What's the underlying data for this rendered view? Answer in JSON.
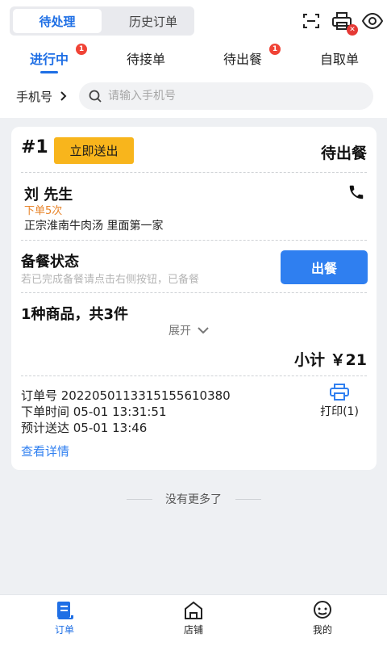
{
  "header": {
    "seg_tabs": [
      {
        "label": "待处理"
      },
      {
        "label": "历史订单"
      }
    ]
  },
  "tabs": [
    {
      "label": "进行中",
      "badge": "1"
    },
    {
      "label": "待接单"
    },
    {
      "label": "待出餐",
      "badge": "1"
    },
    {
      "label": "自取单"
    }
  ],
  "search": {
    "filter_label": "手机号",
    "placeholder": "请输入手机号"
  },
  "order": {
    "number": "#1",
    "deliver_now_label": "立即送出",
    "status": "待出餐",
    "customer_name": "刘 先生",
    "order_count": "下单5次",
    "address": "正宗淮南牛肉汤 里面第一家",
    "prep_title": "备餐状态",
    "prep_hint": "若已完成备餐请点击右侧按钮，已备餐",
    "serve_label": "出餐",
    "goods_summary": "1种商品，共3件",
    "expand_label": "展开",
    "subtotal": "小计 ￥21",
    "order_id_line": "订单号 2022050113315155610380",
    "order_time_line": "下单时间 05-01 13:31:51",
    "delivery_time_line": "预计送达 05-01 13:46",
    "print_label": "打印(1)",
    "detail_link": "查看详情"
  },
  "footer_text": "没有更多了",
  "bottom_nav": [
    {
      "label": "订单"
    },
    {
      "label": "店铺"
    },
    {
      "label": "我的"
    }
  ],
  "colors": {
    "accent": "#1f6fe5",
    "button": "#2f7ff0",
    "deliver": "#f8b51c",
    "badge": "#f04336"
  }
}
